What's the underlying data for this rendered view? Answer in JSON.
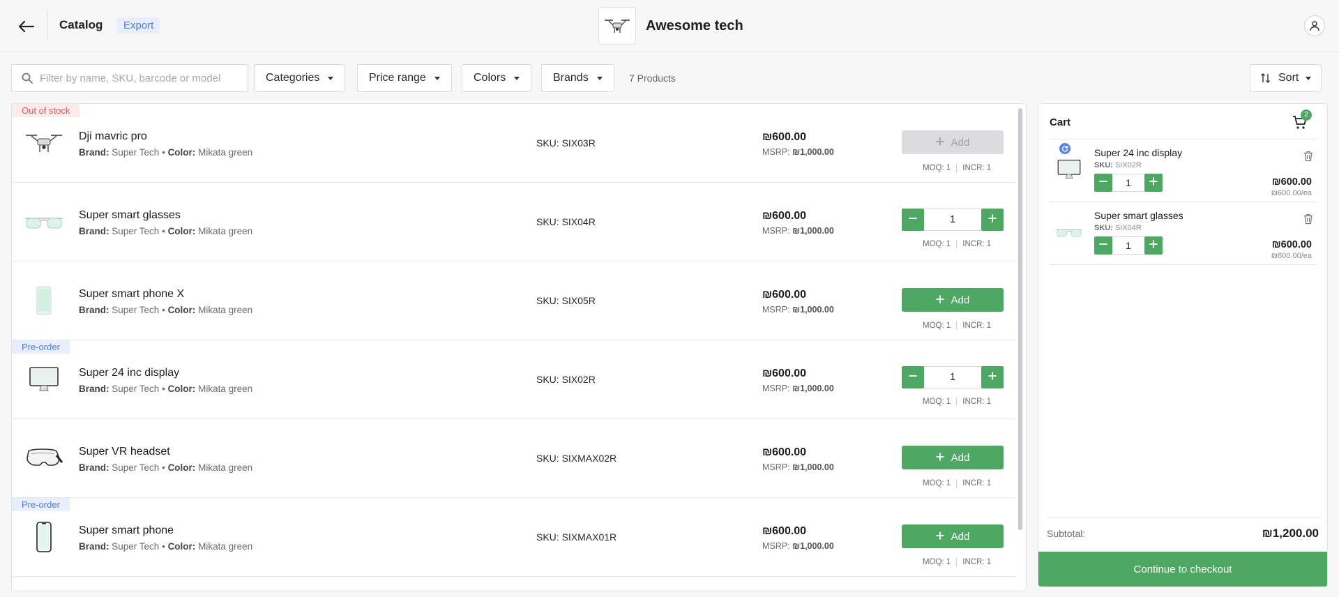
{
  "header": {
    "title": "Catalog",
    "export_label": "Export",
    "store_name": "Awesome tech"
  },
  "filters": {
    "search_placeholder": "Filter by name, SKU, barcode or model",
    "categories": "Categories",
    "price_range": "Price range",
    "colors": "Colors",
    "brands": "Brands",
    "count": "7 Products",
    "sort": "Sort"
  },
  "labels": {
    "brand": "Brand:",
    "color": "Color:",
    "msrp": "MSRP:",
    "moq": "MOQ: 1",
    "incr": "INCR: 1",
    "add": "Add"
  },
  "products": [
    {
      "name": "Dji mavric pro",
      "brand": "Super Tech",
      "color": "Mikata green",
      "sku": "SKU: SIX03R",
      "price": "₪600.00",
      "msrp": "₪1,000.00",
      "badge": "Out of stock",
      "state": "disabled",
      "qty": "",
      "icon": "drone-icon"
    },
    {
      "name": "Super smart glasses",
      "brand": "Super Tech",
      "color": "Mikata green",
      "sku": "SKU: SIX04R",
      "price": "₪600.00",
      "msrp": "₪1,000.00",
      "badge": "",
      "state": "stepper",
      "qty": "1",
      "icon": "glasses-icon"
    },
    {
      "name": "Super smart phone X",
      "brand": "Super Tech",
      "color": "Mikata green",
      "sku": "SKU: SIX05R",
      "price": "₪600.00",
      "msrp": "₪1,000.00",
      "badge": "",
      "state": "add",
      "qty": "",
      "icon": "phone-icon"
    },
    {
      "name": "Super 24 inc display",
      "brand": "Super Tech",
      "color": "Mikata green",
      "sku": "SKU: SIX02R",
      "price": "₪600.00",
      "msrp": "₪1,000.00",
      "badge": "Pre-order",
      "state": "stepper",
      "qty": "1",
      "icon": "monitor-icon"
    },
    {
      "name": "Super VR headset",
      "brand": "Super Tech",
      "color": "Mikata green",
      "sku": "SKU: SIXMAX02R",
      "price": "₪600.00",
      "msrp": "₪1,000.00",
      "badge": "",
      "state": "add",
      "qty": "",
      "icon": "vr-headset-icon"
    },
    {
      "name": "Super smart phone",
      "brand": "Super Tech",
      "color": "Mikata green",
      "sku": "SKU: SIXMAX01R",
      "price": "₪600.00",
      "msrp": "₪1,000.00",
      "badge": "Pre-order",
      "state": "add",
      "qty": "",
      "icon": "smartphone-icon"
    }
  ],
  "cart": {
    "title": "Cart",
    "count": "2",
    "items": [
      {
        "name": "Super 24 inc display",
        "sku_label": "SKU:",
        "sku": "SIX02R",
        "qty": "1",
        "price": "₪600.00",
        "each": "₪600.00/ea",
        "icon": "monitor-icon"
      },
      {
        "name": "Super smart glasses",
        "sku_label": "SKU:",
        "sku": "SIX04R",
        "qty": "1",
        "price": "₪600.00",
        "each": "₪600.00/ea",
        "icon": "glasses-icon"
      }
    ],
    "subtotal_label": "Subtotal:",
    "subtotal": "₪1,200.00",
    "checkout": "Continue to checkout"
  },
  "colors": {
    "accent_green": "#4ea863",
    "accent_blue": "#4c7be0",
    "out_of_stock_red": "#e05555"
  }
}
